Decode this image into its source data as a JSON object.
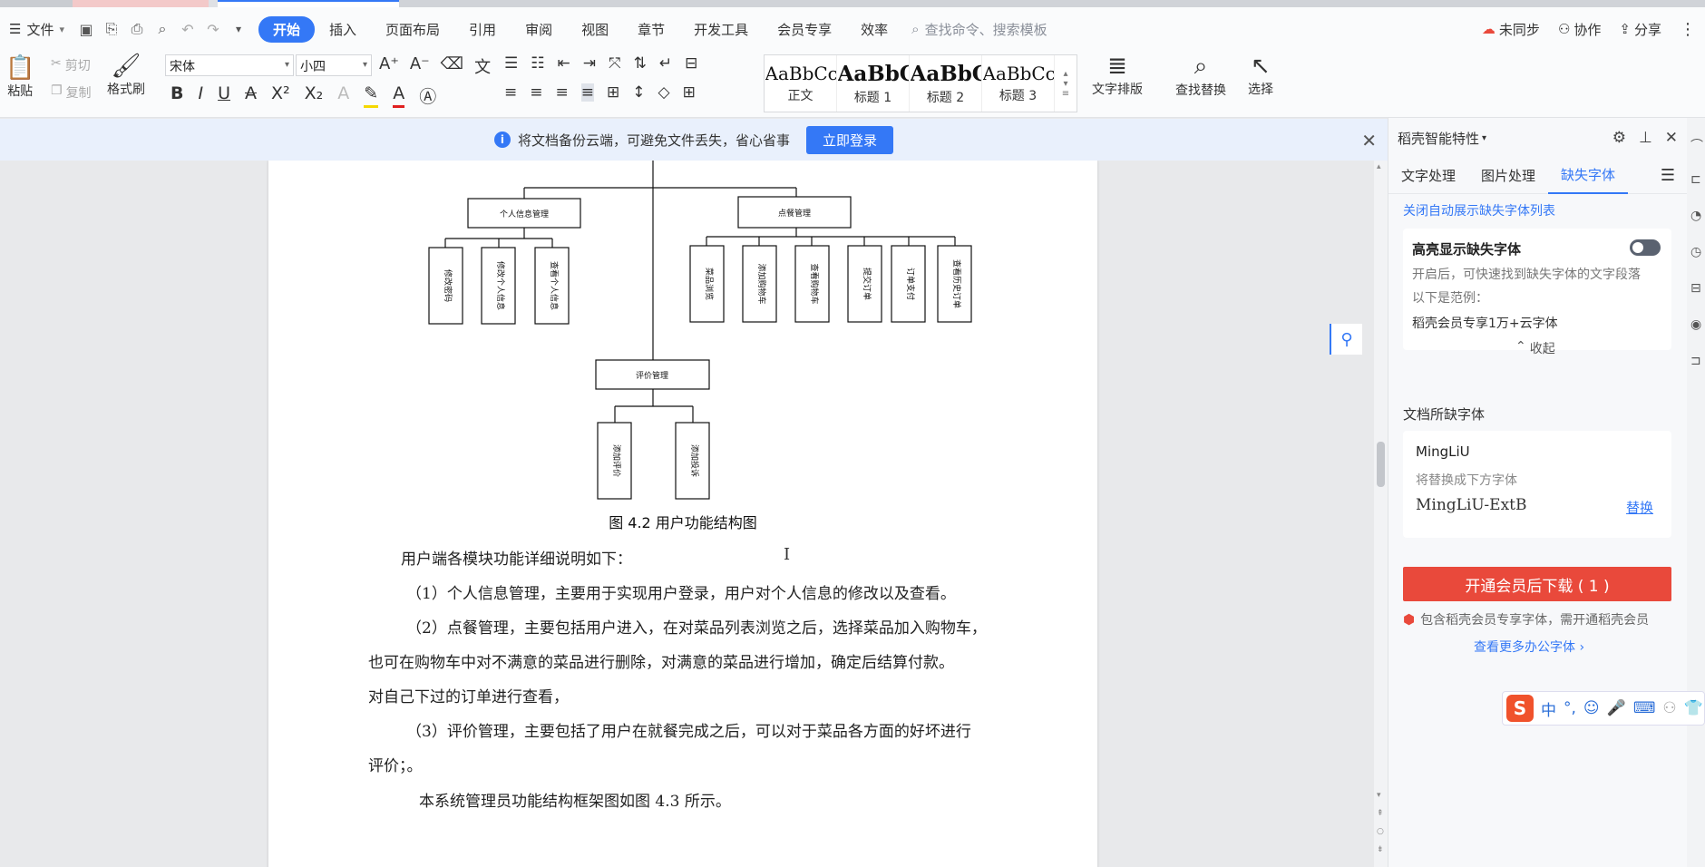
{
  "menubar": {
    "file_label": "文件",
    "tabs": [
      "开始",
      "插入",
      "页面布局",
      "引用",
      "审阅",
      "视图",
      "章节",
      "开发工具",
      "会员专享",
      "效率"
    ],
    "active_tab": "开始",
    "search_placeholder": "查找命令、搜索模板",
    "sync_label": "未同步",
    "collab_label": "协作",
    "share_label": "分享"
  },
  "ribbon": {
    "paste_label": "粘贴",
    "cut_label": "剪切",
    "copy_label": "复制",
    "format_painter_label": "格式刷",
    "font_name": "宋体",
    "font_size": "小四",
    "styles": [
      {
        "sample": "AaBbCcI",
        "name": "正文"
      },
      {
        "sample": "AaBbC",
        "name": "标题 1"
      },
      {
        "sample": "AaBbC",
        "name": "标题 2"
      },
      {
        "sample": "AaBbCc",
        "name": "标题 3"
      }
    ],
    "text_layout_label": "文字排版",
    "find_replace_label": "查找替换",
    "select_label": "选择"
  },
  "notice": {
    "text": "将文档备份云端，可避免文件丢失，省心省事",
    "login_label": "立即登录"
  },
  "diagram": {
    "boxes": {
      "personal": "个人信息管理",
      "order": "点餐管理",
      "review": "评价管理",
      "p1": "修改密码",
      "p2": "修改个人信息",
      "p3": "查看个人信息",
      "o1": "菜品浏览",
      "o2": "添加购物车",
      "o3": "查看购物车",
      "o4": "提交订单",
      "o5": "订单支付",
      "o6": "查看历史订单",
      "r1": "添加评价",
      "r2": "添加投诉"
    }
  },
  "document": {
    "figure_caption": "图 4.2 用户功能结构图",
    "lines": [
      "用户端各模块功能详细说明如下：",
      "（1）个人信息管理，主要用于实现用户登录，用户对个人信息的修改以及查看。",
      "（2）点餐管理，主要包括用户进入，在对菜品列表浏览之后，选择菜品加入购物车，",
      "也可在购物车中对不满意的菜品进行删除，对满意的菜品进行增加，确定后结算付款。",
      "对自己下过的订单进行查看，",
      "（3）评价管理，主要包括了用户在就餐完成之后，可以对于菜品各方面的好坏进行",
      "评价；。",
      "本系统管理员功能结构框架图如图 4.3 所示。"
    ]
  },
  "sidebar": {
    "title": "稻壳智能特性",
    "tabs": [
      "文字处理",
      "图片处理",
      "缺失字体"
    ],
    "active_tab": "缺失字体",
    "close_auto_link": "关闭自动展示缺失字体列表",
    "highlight_title": "高亮显示缺失字体",
    "highlight_desc": "开启后，可快速找到缺失字体的文字段落",
    "example_label": "以下是范例：",
    "example_text": "稻壳会员专享1万+云字体",
    "collapse_label": "收起",
    "missing_fonts_label": "文档所缺字体",
    "missing_font_name": "MingLiU",
    "replace_hint": "将替换成下方字体",
    "replacement_font": "MingLiU-ExtB",
    "replace_label": "替换",
    "download_btn": "开通会员后下载 ( 1 )",
    "member_note": "包含稻壳会员专享字体，需开通稻壳会员",
    "more_fonts_link": "查看更多办公字体"
  },
  "ime": {
    "mode": "中"
  },
  "colors": {
    "accent": "#3478f6",
    "download_red": "#e9493b"
  }
}
